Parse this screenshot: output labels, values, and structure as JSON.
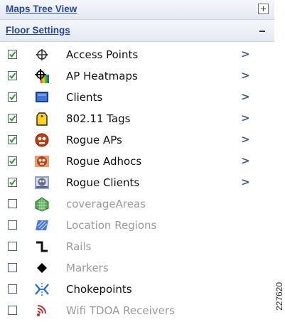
{
  "maps_tree_view": {
    "title": "Maps Tree View",
    "expand_icon": "plus-box-icon"
  },
  "floor_settings": {
    "title": "Floor Settings",
    "collapse_icon": "minus-icon",
    "items": [
      {
        "label": "Access Points",
        "checked": true,
        "enabled": true,
        "icon": "access-point-icon",
        "submenu": true
      },
      {
        "label": "AP Heatmaps",
        "checked": true,
        "enabled": true,
        "icon": "heatmap-icon",
        "submenu": true
      },
      {
        "label": "Clients",
        "checked": true,
        "enabled": true,
        "icon": "client-icon",
        "submenu": true
      },
      {
        "label": "802.11 Tags",
        "checked": true,
        "enabled": true,
        "icon": "tag-icon",
        "submenu": true
      },
      {
        "label": "Rogue APs",
        "checked": true,
        "enabled": true,
        "icon": "rogue-ap-icon",
        "submenu": true
      },
      {
        "label": "Rogue Adhocs",
        "checked": true,
        "enabled": true,
        "icon": "rogue-adhoc-icon",
        "submenu": true
      },
      {
        "label": "Rogue Clients",
        "checked": true,
        "enabled": true,
        "icon": "rogue-client-icon",
        "submenu": true
      },
      {
        "label": "coverageAreas",
        "checked": false,
        "enabled": false,
        "icon": "coverage-area-icon",
        "submenu": false
      },
      {
        "label": "Location Regions",
        "checked": false,
        "enabled": false,
        "icon": "location-region-icon",
        "submenu": false
      },
      {
        "label": "Rails",
        "checked": false,
        "enabled": false,
        "icon": "rail-icon",
        "submenu": false
      },
      {
        "label": "Markers",
        "checked": false,
        "enabled": false,
        "icon": "marker-icon",
        "submenu": false
      },
      {
        "label": "Chokepoints",
        "checked": false,
        "enabled": true,
        "icon": "chokepoint-icon",
        "submenu": false
      },
      {
        "label": "Wifi TDOA Receivers",
        "checked": false,
        "enabled": false,
        "icon": "wifi-tdoa-receiver-icon",
        "submenu": false
      }
    ]
  },
  "chevron_glyph": ">",
  "figure_number": "227620",
  "colors": {
    "header_link": "#27479a",
    "disabled_text": "#9a9a9a",
    "checkmark": "#2e9a2e"
  }
}
